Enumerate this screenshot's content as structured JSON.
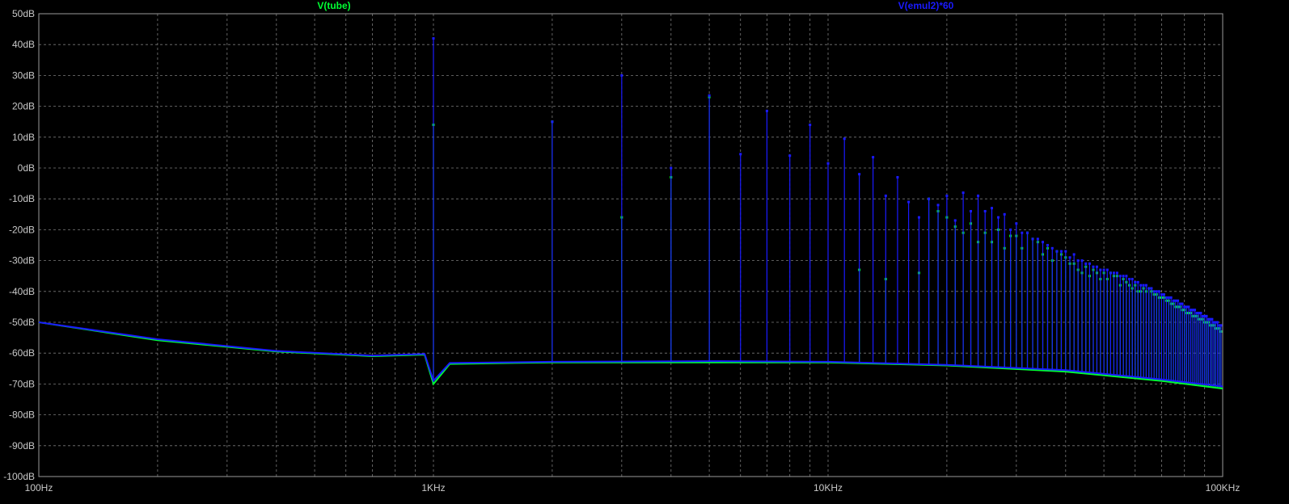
{
  "chart_data": {
    "type": "line",
    "x_scale": "log",
    "xlim": [
      100,
      100000
    ],
    "ylim": [
      -100,
      50
    ],
    "grid": true,
    "background": "#000000",
    "grid_color": "#7a7a7a",
    "x_ticks": [
      {
        "value": 100,
        "label": "100Hz"
      },
      {
        "value": 1000,
        "label": "1KHz"
      },
      {
        "value": 10000,
        "label": "10KHz"
      },
      {
        "value": 100000,
        "label": "100KHz"
      }
    ],
    "y_ticks": [
      {
        "value": 50,
        "label": "50dB"
      },
      {
        "value": 40,
        "label": "40dB"
      },
      {
        "value": 30,
        "label": "30dB"
      },
      {
        "value": 20,
        "label": "20dB"
      },
      {
        "value": 10,
        "label": "10dB"
      },
      {
        "value": 0,
        "label": "0dB"
      },
      {
        "value": -10,
        "label": "-10dB"
      },
      {
        "value": -20,
        "label": "-20dB"
      },
      {
        "value": -30,
        "label": "-30dB"
      },
      {
        "value": -40,
        "label": "-40dB"
      },
      {
        "value": -50,
        "label": "-50dB"
      },
      {
        "value": -60,
        "label": "-60dB"
      },
      {
        "value": -70,
        "label": "-70dB"
      },
      {
        "value": -80,
        "label": "-80dB"
      },
      {
        "value": -90,
        "label": "-90dB"
      },
      {
        "value": -100,
        "label": "-100dB"
      }
    ],
    "series": [
      {
        "name": "V(tube)",
        "color": "#00ff33",
        "floor": [
          [
            100,
            -50
          ],
          [
            200,
            -55.8
          ],
          [
            400,
            -59.5
          ],
          [
            700,
            -61
          ],
          [
            950,
            -60.5
          ],
          [
            1000,
            -70
          ],
          [
            1100,
            -63.5
          ],
          [
            2000,
            -63
          ],
          [
            5000,
            -63
          ],
          [
            10000,
            -63
          ],
          [
            20000,
            -64
          ],
          [
            40000,
            -66
          ],
          [
            70000,
            -69
          ],
          [
            100000,
            -71.5
          ]
        ],
        "peaks": [
          [
            1000,
            14
          ],
          [
            2000,
            15
          ],
          [
            3000,
            -16
          ],
          [
            4000,
            -3
          ],
          [
            5000,
            23
          ],
          [
            6000,
            -100
          ],
          [
            7000,
            -100
          ],
          [
            8000,
            -100
          ],
          [
            9000,
            -100
          ],
          [
            10000,
            -100
          ],
          [
            11000,
            -100
          ],
          [
            12000,
            -33
          ],
          [
            13000,
            -100
          ],
          [
            14000,
            -36
          ],
          [
            15000,
            -100
          ],
          [
            16000,
            -100
          ],
          [
            17000,
            -34
          ],
          [
            18000,
            -10
          ],
          [
            19000,
            -14
          ],
          [
            20000,
            -16
          ],
          [
            21000,
            -19
          ],
          [
            22000,
            -21
          ],
          [
            23000,
            -18
          ],
          [
            24000,
            -24
          ],
          [
            25000,
            -21
          ],
          [
            26000,
            -24
          ],
          [
            27000,
            -20
          ],
          [
            28000,
            -26
          ],
          [
            29000,
            -22
          ],
          [
            30000,
            -22
          ],
          [
            31000,
            -26
          ],
          [
            32000,
            -21
          ],
          [
            33000,
            -23
          ],
          [
            34000,
            -24
          ],
          [
            35000,
            -28
          ],
          [
            36000,
            -26
          ],
          [
            37000,
            -30
          ],
          [
            38000,
            -27
          ],
          [
            39000,
            -28
          ],
          [
            40000,
            -29
          ],
          [
            41000,
            -31
          ],
          [
            42000,
            -31
          ],
          [
            43000,
            -33
          ],
          [
            44000,
            -34
          ],
          [
            45000,
            -32
          ],
          [
            46000,
            -35
          ],
          [
            47000,
            -33
          ],
          [
            48000,
            -34
          ],
          [
            49000,
            -36
          ],
          [
            50000,
            -34
          ],
          [
            51000,
            -36
          ],
          [
            52000,
            -34
          ],
          [
            53000,
            -35
          ],
          [
            54000,
            -35
          ],
          [
            55000,
            -38
          ],
          [
            56000,
            -36
          ],
          [
            57000,
            -37
          ],
          [
            58000,
            -38
          ],
          [
            59000,
            -39
          ],
          [
            60000,
            -38
          ],
          [
            61000,
            -40
          ],
          [
            62000,
            -40
          ],
          [
            63000,
            -39
          ],
          [
            64000,
            -40
          ],
          [
            65000,
            -39
          ],
          [
            66000,
            -40
          ],
          [
            67000,
            -41
          ],
          [
            68000,
            -41
          ],
          [
            69000,
            -42
          ],
          [
            70000,
            -42
          ],
          [
            71000,
            -42
          ],
          [
            72000,
            -43
          ],
          [
            73000,
            -43
          ],
          [
            74000,
            -44
          ],
          [
            75000,
            -44
          ],
          [
            76000,
            -45
          ],
          [
            77000,
            -45
          ],
          [
            78000,
            -45
          ],
          [
            79000,
            -46
          ],
          [
            80000,
            -46
          ],
          [
            81000,
            -47
          ],
          [
            82000,
            -47
          ],
          [
            83000,
            -47
          ],
          [
            84000,
            -48
          ],
          [
            85000,
            -48
          ],
          [
            86000,
            -48
          ],
          [
            87000,
            -49
          ],
          [
            88000,
            -49
          ],
          [
            89000,
            -49
          ],
          [
            90000,
            -50
          ],
          [
            91000,
            -50
          ],
          [
            92000,
            -50
          ],
          [
            93000,
            -51
          ],
          [
            94000,
            -51
          ],
          [
            95000,
            -51
          ],
          [
            96000,
            -52
          ],
          [
            97000,
            -52
          ],
          [
            98000,
            -52
          ],
          [
            99000,
            -53
          ]
        ]
      },
      {
        "name": "V(emul2)*60",
        "color": "#1a1aff",
        "floor": [
          [
            100,
            -50
          ],
          [
            200,
            -55.5
          ],
          [
            400,
            -59.3
          ],
          [
            700,
            -60.8
          ],
          [
            950,
            -60.3
          ],
          [
            1000,
            -69
          ],
          [
            1100,
            -63.2
          ],
          [
            2000,
            -62.8
          ],
          [
            5000,
            -62.6
          ],
          [
            10000,
            -62.8
          ],
          [
            20000,
            -63.8
          ],
          [
            40000,
            -65.5
          ],
          [
            70000,
            -68.5
          ],
          [
            100000,
            -70.8
          ]
        ],
        "peaks": [
          [
            1000,
            42
          ],
          [
            2000,
            15
          ],
          [
            3000,
            30
          ],
          [
            4000,
            0
          ],
          [
            5000,
            23.5
          ],
          [
            6000,
            4.5
          ],
          [
            7000,
            18.5
          ],
          [
            8000,
            4
          ],
          [
            9000,
            14
          ],
          [
            10000,
            1.5
          ],
          [
            11000,
            9.5
          ],
          [
            12000,
            -2
          ],
          [
            13000,
            3.5
          ],
          [
            14000,
            -9
          ],
          [
            15000,
            -3
          ],
          [
            16000,
            -11
          ],
          [
            17000,
            -16
          ],
          [
            18000,
            -10
          ],
          [
            19000,
            -12
          ],
          [
            20000,
            -9
          ],
          [
            21000,
            -17
          ],
          [
            22000,
            -8
          ],
          [
            23000,
            -14
          ],
          [
            24000,
            -9
          ],
          [
            25000,
            -14
          ],
          [
            26000,
            -13
          ],
          [
            27000,
            -16
          ],
          [
            28000,
            -15
          ],
          [
            29000,
            -20
          ],
          [
            30000,
            -18
          ],
          [
            31000,
            -21
          ],
          [
            32000,
            -21
          ],
          [
            33000,
            -23
          ],
          [
            34000,
            -23
          ],
          [
            35000,
            -24
          ],
          [
            36000,
            -25
          ],
          [
            37000,
            -26
          ],
          [
            38000,
            -27
          ],
          [
            39000,
            -27
          ],
          [
            40000,
            -27
          ],
          [
            41000,
            -29
          ],
          [
            42000,
            -28
          ],
          [
            43000,
            -30
          ],
          [
            44000,
            -30
          ],
          [
            45000,
            -31
          ],
          [
            46000,
            -31
          ],
          [
            47000,
            -32
          ],
          [
            48000,
            -32
          ],
          [
            49000,
            -33
          ],
          [
            50000,
            -33
          ],
          [
            51000,
            -33
          ],
          [
            52000,
            -34
          ],
          [
            53000,
            -34
          ],
          [
            54000,
            -34
          ],
          [
            55000,
            -35
          ],
          [
            56000,
            -35
          ],
          [
            57000,
            -35
          ],
          [
            58000,
            -36
          ],
          [
            59000,
            -36
          ],
          [
            60000,
            -37
          ],
          [
            61000,
            -37
          ],
          [
            62000,
            -38
          ],
          [
            63000,
            -38
          ],
          [
            64000,
            -38
          ],
          [
            65000,
            -39
          ],
          [
            66000,
            -39
          ],
          [
            67000,
            -40
          ],
          [
            68000,
            -40
          ],
          [
            69000,
            -40
          ],
          [
            70000,
            -41
          ],
          [
            71000,
            -41
          ],
          [
            72000,
            -42
          ],
          [
            73000,
            -42
          ],
          [
            74000,
            -42
          ],
          [
            75000,
            -43
          ],
          [
            76000,
            -43
          ],
          [
            77000,
            -43
          ],
          [
            78000,
            -44
          ],
          [
            79000,
            -44
          ],
          [
            80000,
            -45
          ],
          [
            81000,
            -45
          ],
          [
            82000,
            -45
          ],
          [
            83000,
            -46
          ],
          [
            84000,
            -46
          ],
          [
            85000,
            -46
          ],
          [
            86000,
            -47
          ],
          [
            87000,
            -47
          ],
          [
            88000,
            -47
          ],
          [
            89000,
            -48
          ],
          [
            90000,
            -48
          ],
          [
            91000,
            -48
          ],
          [
            92000,
            -49
          ],
          [
            93000,
            -49
          ],
          [
            94000,
            -49
          ],
          [
            95000,
            -50
          ],
          [
            96000,
            -50
          ],
          [
            97000,
            -50
          ],
          [
            98000,
            -51
          ],
          [
            99000,
            -51
          ]
        ]
      }
    ]
  }
}
